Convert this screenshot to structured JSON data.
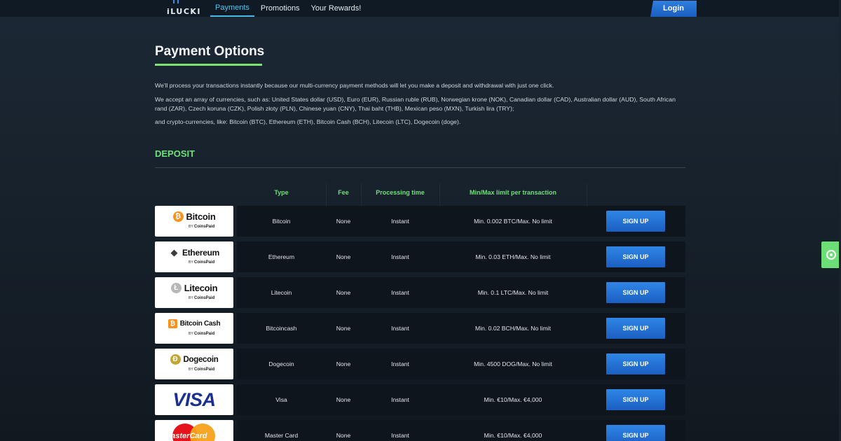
{
  "header": {
    "logo_text": "iLUCKI",
    "nav": [
      {
        "label": "Payments"
      },
      {
        "label": "Promotions"
      },
      {
        "label": "Your Rewards!"
      }
    ],
    "login_label": "Login"
  },
  "page": {
    "title": "Payment Options",
    "para1": "We'll process your transactions instantly because our multi-currency payment methods will let you make a deposit and withdrawal with just one click.",
    "para2": "We accept an array of currencies, such as: United States dollar (USD), Euro (EUR), Russian ruble (RUB), Norwegian krone (NOK), Canadian dollar (CAD), Australian dollar (AUD), South African rand (ZAR), Czech koruna (CZK), Polish złoty (PLN), Chinese yuan (CNY), Thai baht (THB), Mexican peso (MXN), Turkish lira (TRY);",
    "para3": "and crypto-currencies, like: Bitcoin (BTC), Ethereum (ETH), Bitcoin Cash (BCH), Litecoin (LTC), Dogecoin (doge)."
  },
  "deposit": {
    "section_title": "DEPOSIT",
    "columns": {
      "type": "Type",
      "fee": "Fee",
      "processing": "Processing time",
      "limit": "Min/Max limit per transaction"
    },
    "byline": {
      "by": "BY",
      "brand": "CoinsPaid"
    },
    "rows": [
      {
        "logo_name": "Bitcoin",
        "coin_symbol": "₿",
        "coin_color": "#f7931a",
        "type": "Bitcoin",
        "fee": "None",
        "processing": "Instant",
        "limit": "Min. 0.002 BTC/Max. No limit",
        "action": "SIGN UP"
      },
      {
        "logo_name": "Ethereum",
        "coin_symbol": "◆",
        "coin_color": "#3c3c3d",
        "type": "Ethereum",
        "fee": "None",
        "processing": "Instant",
        "limit": "Min. 0.03 ETH/Max. No limit",
        "action": "SIGN UP"
      },
      {
        "logo_name": "Litecoin",
        "coin_symbol": "Ł",
        "coin_color": "#b8b8b8",
        "type": "Litecoin",
        "fee": "None",
        "processing": "Instant",
        "limit": "Min. 0.1 LTC/Max. No limit",
        "action": "SIGN UP"
      },
      {
        "logo_name": "Bitcoin Cash",
        "coin_symbol": "₿",
        "coin_color": "#f7931a",
        "type": "Bitcoincash",
        "fee": "None",
        "processing": "Instant",
        "limit": "Min. 0.02 BCH/Max. No limit",
        "action": "SIGN UP"
      },
      {
        "logo_name": "Dogecoin",
        "coin_symbol": "Ð",
        "coin_color": "#c2a633",
        "type": "Dogecoin",
        "fee": "None",
        "processing": "Instant",
        "limit": "Min. 4500 DOG/Max. No limit",
        "action": "SIGN UP"
      },
      {
        "logo_name": "VISA",
        "type": "Visa",
        "fee": "None",
        "processing": "Instant",
        "limit": "Min. €10/Max. €4,000",
        "action": "SIGN UP"
      },
      {
        "logo_name": "MasterCard",
        "type": "Master Card",
        "fee": "None",
        "processing": "Instant",
        "limit": "Min. €10/Max. €4,000",
        "action": "SIGN UP"
      }
    ]
  },
  "colors": {
    "accent_green": "#6ee07a",
    "accent_blue": "#2f86e6",
    "background": "#1c2835"
  },
  "icons": {
    "support_chat": "support-headset-icon"
  }
}
